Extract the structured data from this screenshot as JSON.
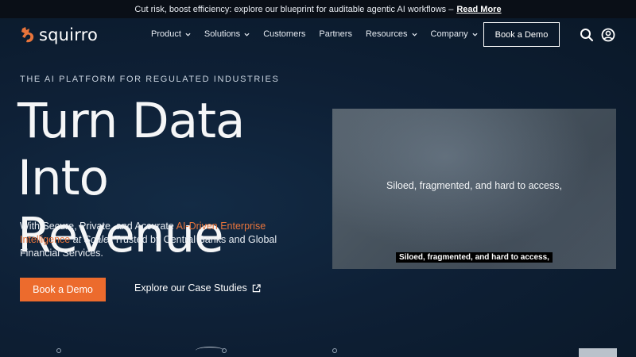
{
  "announcement": {
    "text": "Cut risk, boost efficiency: explore our blueprint for auditable agentic AI workflows –",
    "link": "Read More"
  },
  "brand": {
    "name": "squirro",
    "logo_color": "#e8743b"
  },
  "nav": {
    "items": [
      {
        "label": "Product",
        "dropdown": true
      },
      {
        "label": "Solutions",
        "dropdown": true
      },
      {
        "label": "Customers",
        "dropdown": false
      },
      {
        "label": "Partners",
        "dropdown": false
      },
      {
        "label": "Resources",
        "dropdown": true
      },
      {
        "label": "Company",
        "dropdown": true
      }
    ],
    "cta": "Book a Demo",
    "icons": [
      "search-icon",
      "user-icon"
    ]
  },
  "hero": {
    "eyebrow": "THE AI PLATFORM FOR REGULATED INDUSTRIES",
    "headline_line1": "Turn Data",
    "headline_line2": "Into Revenue",
    "sub_part1": "With Secure, Private, and Accurate ",
    "sub_accent": "AI-Driven Enterprise Intelligence",
    "sub_em": "at Scale.",
    "sub_part2": " Trusted by Central Banks and Global Financial Services.",
    "primary_cta": "Book a Demo",
    "secondary_cta": "Explore our Case Studies"
  },
  "video": {
    "caption": "Siloed, fragmented, and hard to access,",
    "subtitle": "Siloed, fragmented, and hard to access,"
  },
  "colors": {
    "accent": "#ec6b2d",
    "background": "#0c1a2b"
  }
}
